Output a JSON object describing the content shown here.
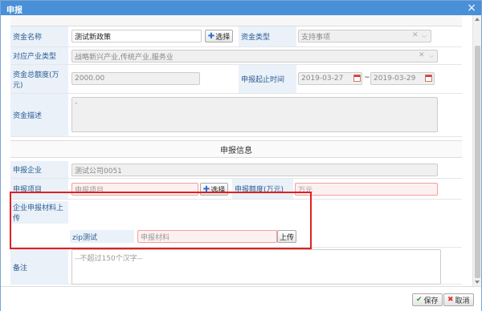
{
  "dialog": {
    "title": "申报",
    "close_glyph": "×"
  },
  "form": {
    "fund_name_label": "资金名称",
    "fund_name_value": "测试新政策",
    "select_label": "选择",
    "fund_type_label": "资金类型",
    "fund_type_value": "支持事项",
    "industry_label": "对应产业类型",
    "industry_value": "战略新兴产业,传统产业,服务业",
    "total_label_line1": "资金总额度(万",
    "total_label_line2": "元)",
    "total_value": "2000.00",
    "period_label": "申报起止时间",
    "start_date": "2019-03-27",
    "date_sep": "~",
    "end_date": "2019-03-29",
    "desc_label": "资金描述",
    "desc_value": "-"
  },
  "apply": {
    "section_title": "申报信息",
    "company_label": "申报企业",
    "company_value": "测试公司0051",
    "project_label": "申报项目",
    "project_placeholder": "申报项目",
    "select_label": "选择",
    "amount_label": "申报额度(万元)",
    "amount_placeholder": "万元",
    "materials_label_line1": "企业申报材料上",
    "materials_label_line2": "传",
    "zip_label": "zip测试",
    "materials_placeholder": "申报材料",
    "upload_label": "上传",
    "remark_label": "备注",
    "remark_placeholder": "--不超过150个汉字--"
  },
  "footer": {
    "save_label": "保存",
    "cancel_label": "取消"
  },
  "colors": {
    "titlebar": "#4a90d9",
    "label_bg": "#eaf1f9",
    "highlight": "#e02020"
  }
}
